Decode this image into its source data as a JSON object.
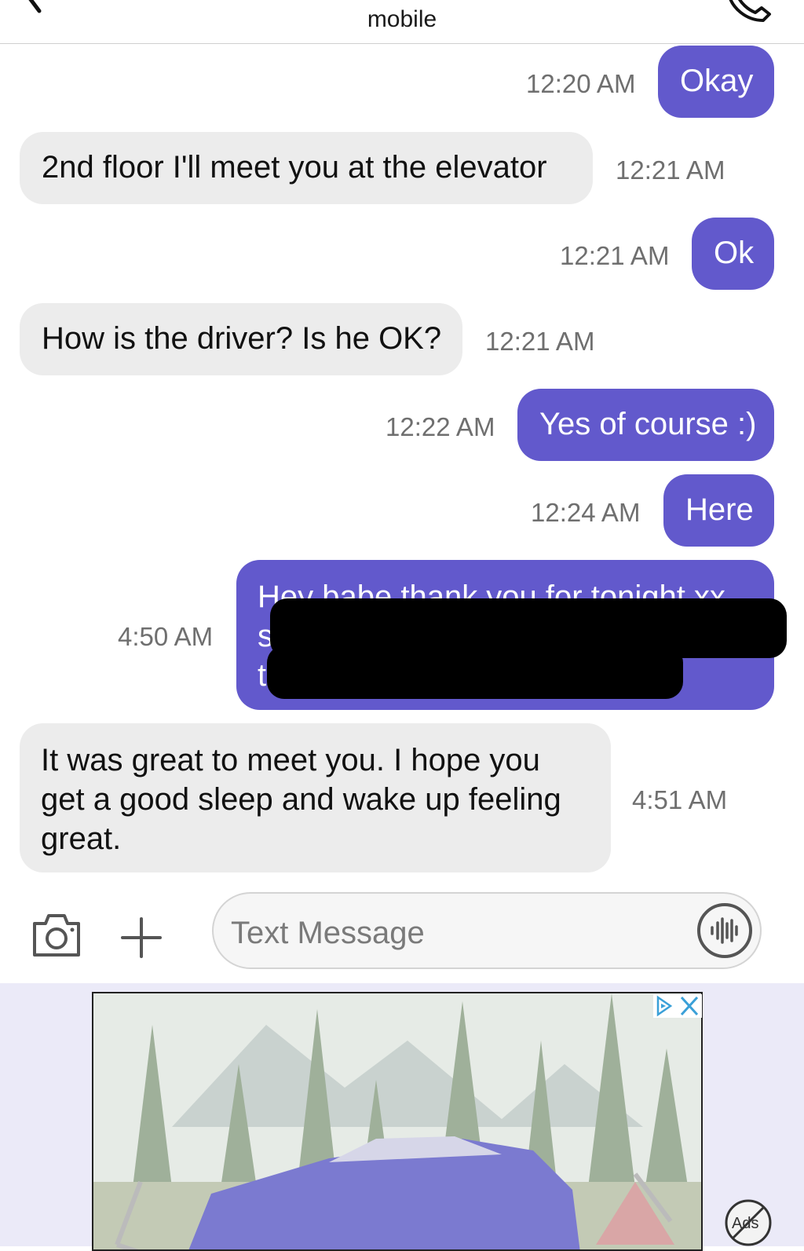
{
  "header": {
    "title": "mobile"
  },
  "messages": [
    {
      "dir": "out",
      "text": "Okay",
      "time": "12:20 AM"
    },
    {
      "dir": "in",
      "text": "2nd floor I'll meet you at the elevator",
      "time": "12:21 AM"
    },
    {
      "dir": "out",
      "text": "Ok",
      "time": "12:21 AM"
    },
    {
      "dir": "in",
      "text": "How is the driver? Is he OK?",
      "time": "12:21 AM"
    },
    {
      "dir": "out",
      "text": "Yes of course :)",
      "time": "12:22 AM"
    },
    {
      "dir": "out",
      "text": "Here",
      "time": "12:24 AM"
    },
    {
      "dir": "out",
      "lines": [
        "Hey babe thank you for tonight xx",
        "s",
        "t"
      ],
      "time": "4:50 AM"
    },
    {
      "dir": "in",
      "lines": [
        "It was great to meet you. I hope you",
        "get a good sleep and wake up feeling",
        "great."
      ],
      "time": "4:51 AM"
    }
  ],
  "composer": {
    "placeholder": "Text Message"
  },
  "ad": {
    "no_ads_label": "Ads"
  },
  "colors": {
    "outgoing": "#6259cc",
    "incoming": "#ececec",
    "ad_background": "#ebeaf8"
  },
  "icons": [
    "back-chevron-icon",
    "phone-icon",
    "camera-icon",
    "plus-icon",
    "voice-wave-icon",
    "adchoices-icon",
    "close-icon",
    "no-ads-icon"
  ]
}
